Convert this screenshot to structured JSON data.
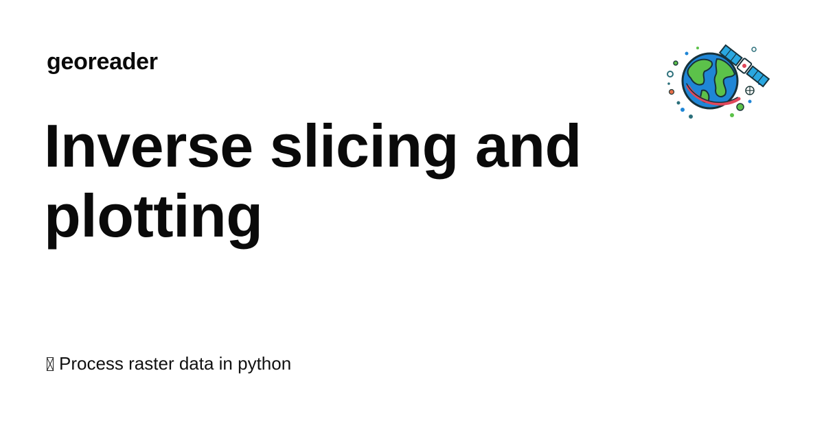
{
  "header": {
    "site_name": "georeader"
  },
  "main": {
    "title": "Inverse slicing and plotting",
    "tagline_icon": "missing-glyph-icon",
    "tagline": "Process raster data in python"
  },
  "logo": {
    "icon": "earth-satellite-logo",
    "colors": {
      "ocean": "#1f86d6",
      "land": "#5cc24a",
      "orbit": "#e0475b",
      "satellite_panel": "#2aa7e0"
    }
  }
}
